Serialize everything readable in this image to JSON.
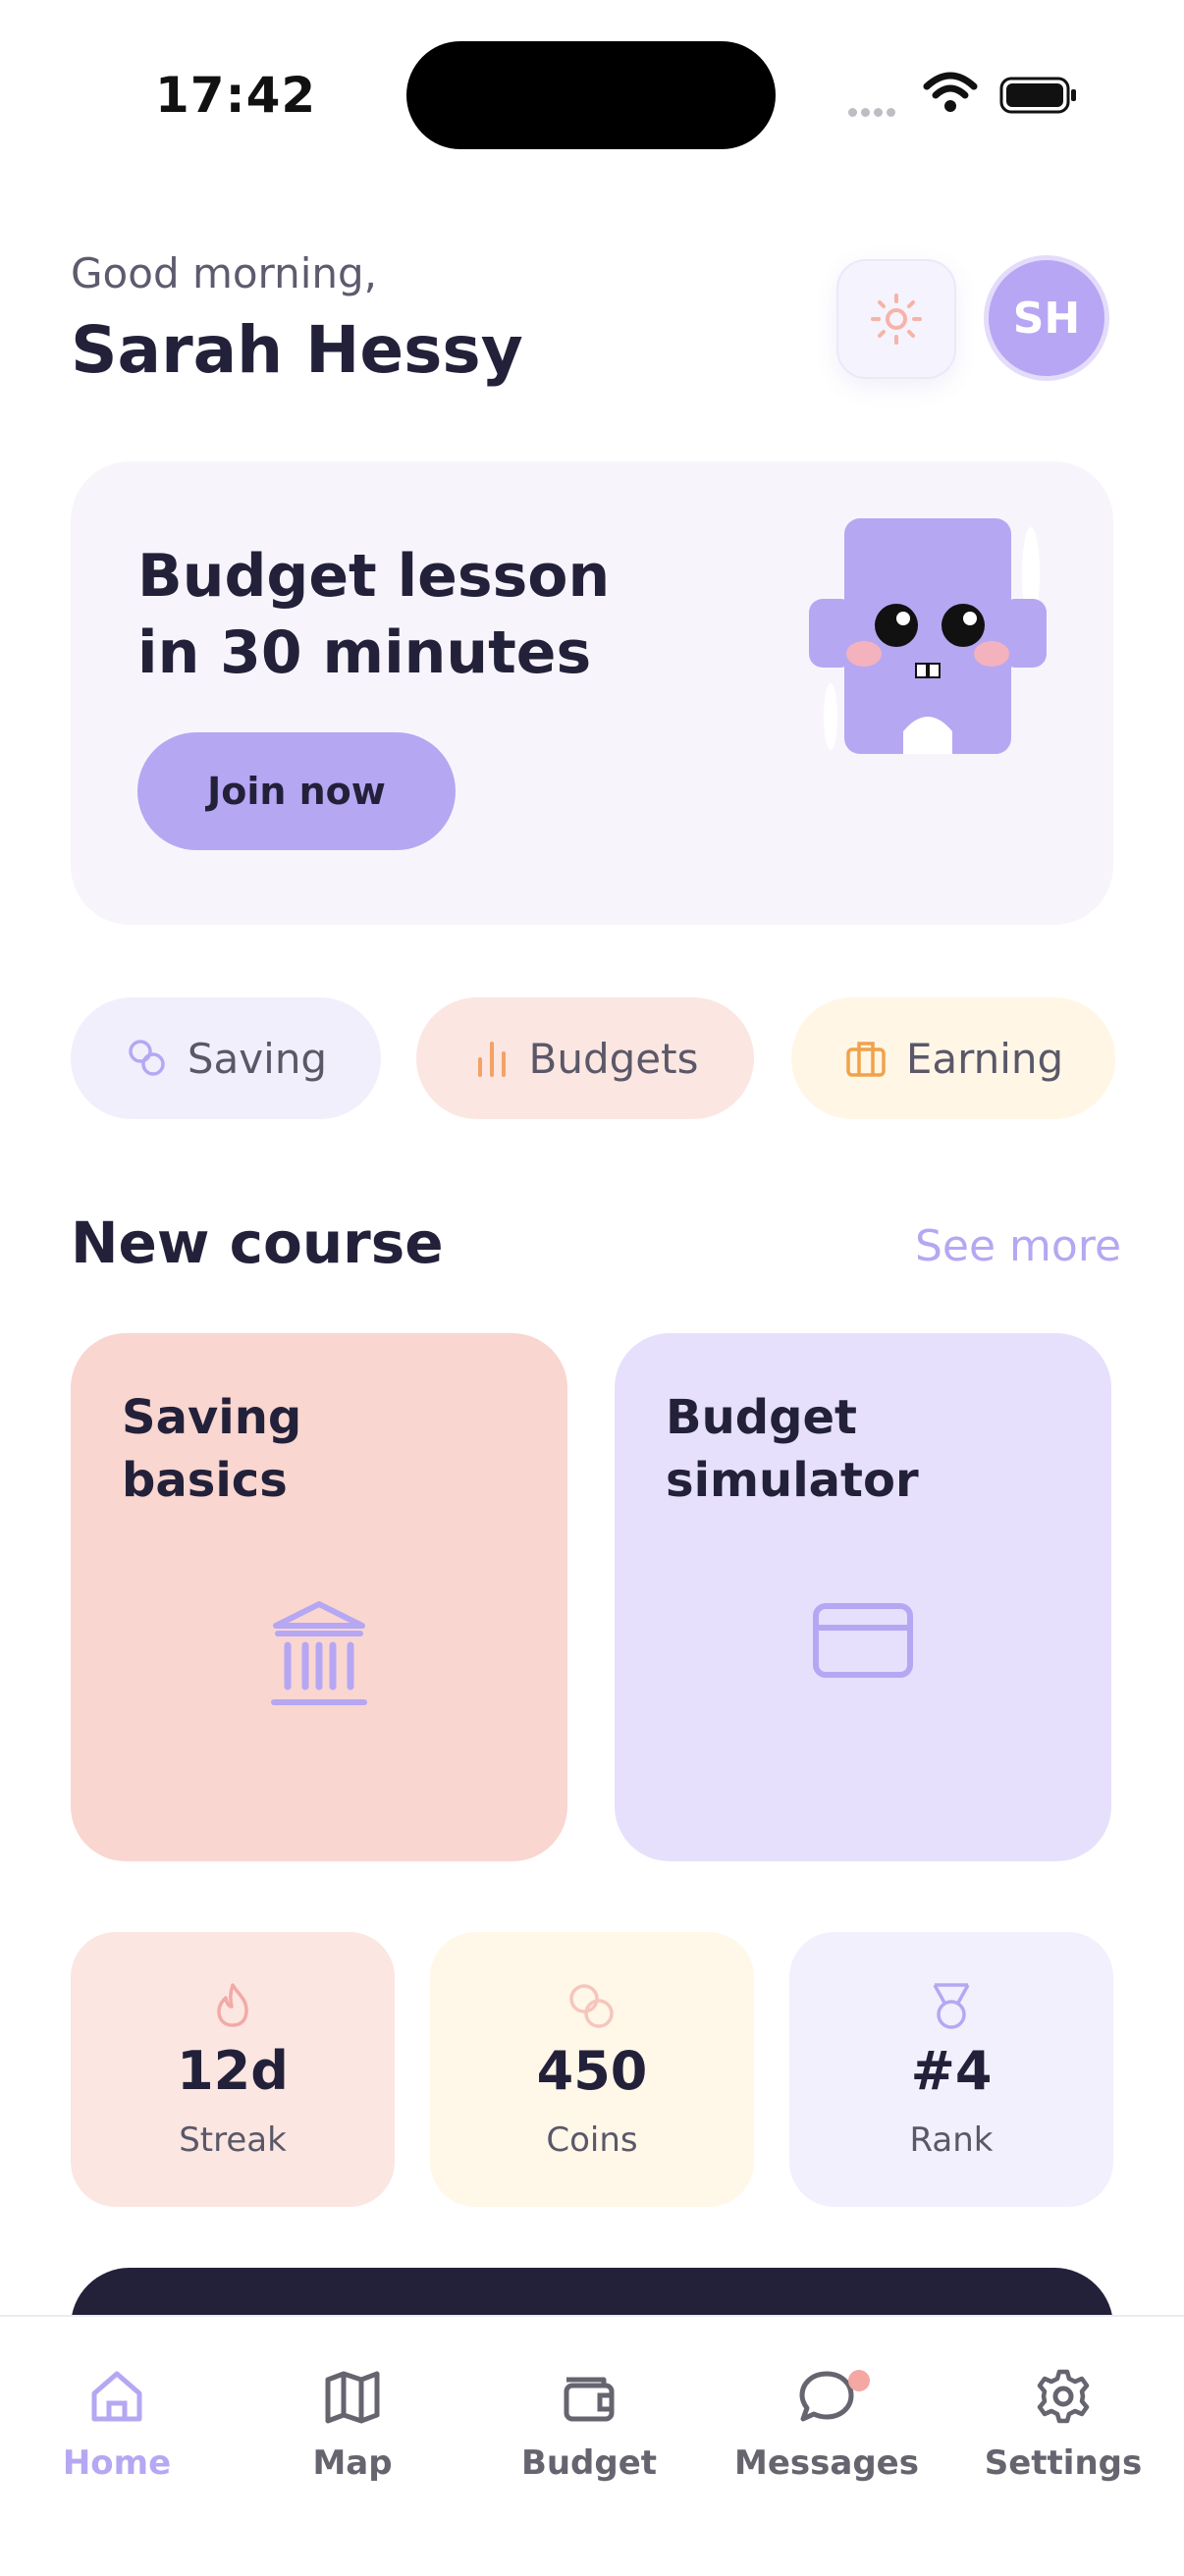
{
  "status_bar": {
    "time": "17:42"
  },
  "header": {
    "greeting": "Good morning,",
    "user_name": "Sarah Hessy",
    "avatar_initials": "SH",
    "theme_icon": "sun-icon"
  },
  "hero": {
    "title_line1": "Budget lesson",
    "title_line2": "in 30 minutes",
    "button_label": "Join now",
    "mascot": "purple-puzzle-mascot"
  },
  "chips": [
    {
      "label": "Saving",
      "icon": "coins-icon",
      "color": "#b6a7f3"
    },
    {
      "label": "Budgets",
      "icon": "bar-chart-icon",
      "color": "#f2a266"
    },
    {
      "label": "Earning",
      "icon": "briefcase-icon",
      "color": "#f0a24a"
    }
  ],
  "new_course": {
    "title": "New course",
    "see_more": "See more",
    "courses": [
      {
        "title_line1": "Saving",
        "title_line2": "basics",
        "icon": "bank-icon"
      },
      {
        "title_line1": "Budget",
        "title_line2": "simulator",
        "icon": "credit-card-icon"
      }
    ]
  },
  "stats": [
    {
      "value": "12d",
      "label": "Streak",
      "icon": "flame-icon"
    },
    {
      "value": "450",
      "label": "Coins",
      "icon": "coins-icon"
    },
    {
      "value": "#4",
      "label": "Rank",
      "icon": "medal-icon"
    }
  ],
  "tabbar": {
    "active": "Home",
    "items": [
      {
        "label": "Home",
        "icon": "home-icon"
      },
      {
        "label": "Map",
        "icon": "map-icon"
      },
      {
        "label": "Budget",
        "icon": "wallet-icon"
      },
      {
        "label": "Messages",
        "icon": "chat-icon"
      },
      {
        "label": "Settings",
        "icon": "gear-icon"
      }
    ]
  },
  "colors": {
    "accent": "#b6a7f3",
    "text_dark": "#23213a"
  }
}
